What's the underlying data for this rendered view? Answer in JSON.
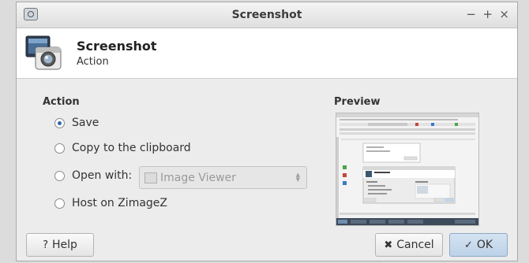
{
  "window": {
    "title": "Screenshot",
    "controls": {
      "minimize": "−",
      "maximize": "+",
      "close": "×"
    }
  },
  "header": {
    "title": "Screenshot",
    "subtitle": "Action",
    "icon": "camera-app-icon"
  },
  "action": {
    "label": "Action",
    "options": [
      {
        "label": "Save",
        "checked": true
      },
      {
        "label": "Copy to the clipboard",
        "checked": false
      },
      {
        "label": "Open with:",
        "checked": false
      },
      {
        "label": "Host on ZimageZ",
        "checked": false
      }
    ],
    "open_with": {
      "value": "Image Viewer",
      "enabled": false,
      "icon": "image-icon"
    }
  },
  "preview": {
    "label": "Preview"
  },
  "buttons": {
    "help": "Help",
    "help_glyph": "?",
    "cancel": "Cancel",
    "cancel_glyph": "✖",
    "ok": "OK",
    "ok_glyph": "✓"
  },
  "colors": {
    "accent": "#2b6aa8",
    "ok_button": "#c8dbee"
  }
}
